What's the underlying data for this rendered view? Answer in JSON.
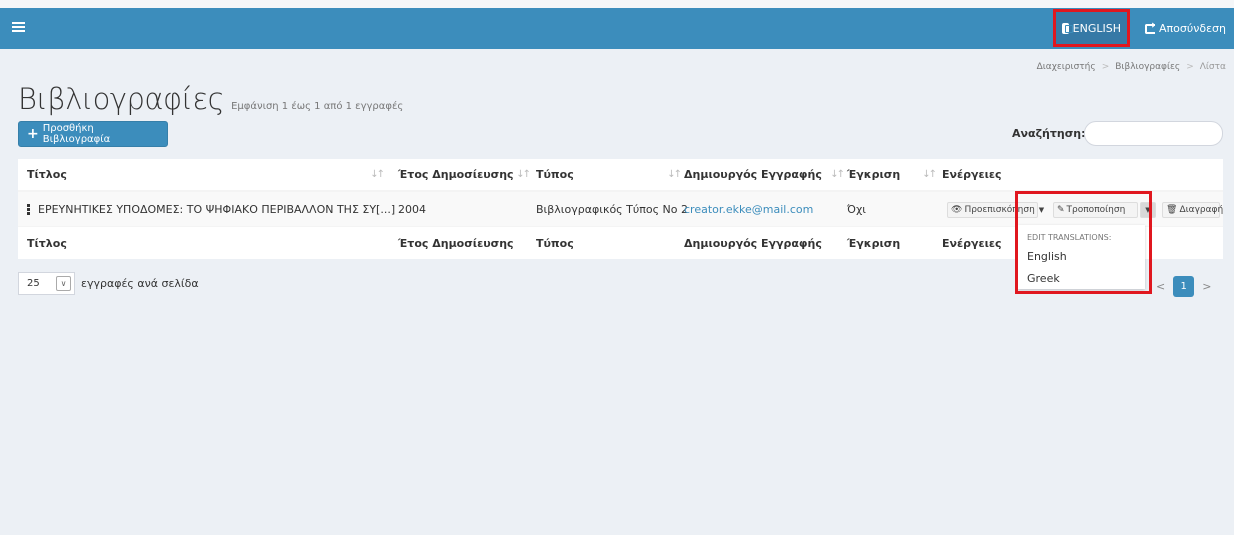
{
  "navbar": {
    "lang_label": "ENGLISH",
    "logout_label": "Αποσύνδεση",
    "lang_icon": "language-icon",
    "logout_icon": "logout-icon"
  },
  "breadcrumb": [
    "Διαχειριστής",
    "Βιβλιογραφίες",
    "Λίστα"
  ],
  "page": {
    "title": "Βιβλιογραφίες",
    "subtitle": "Εμφάνιση 1 έως 1 από 1 εγγραφές"
  },
  "add_button": "Προσθήκη Βιβλιογραφία",
  "search": {
    "label": "Αναζήτηση:",
    "value": ""
  },
  "table": {
    "headers": [
      "Τίτλος",
      "Έτος Δημοσίευσης",
      "Τύπος",
      "Δημιουργός Εγγραφής",
      "Έγκριση",
      "Ενέργειες"
    ],
    "rows": [
      {
        "title": "ΕΡΕΥΝΗΤΙΚΕΣ ΥΠΟΔΟΜΕΣ: ΤΟ ΨΗΦΙΑΚΟ ΠΕΡΙΒΑΛΛΟΝ ΤΗΣ ΣΥ[...]",
        "year": "2004",
        "type": "Βιβλιογραφικός Τύπος Νο 2",
        "creator": "creator.ekke@mail.com",
        "approval": "Όχι"
      }
    ],
    "actions": {
      "preview": "Προεπισκόπηση",
      "edit": "Τροποποίηση",
      "delete": "Διαγραφή"
    }
  },
  "dropdown": {
    "header": "EDIT TRANSLATIONS:",
    "items": [
      "English",
      "Greek"
    ]
  },
  "length": {
    "value": "25",
    "label": "εγγραφές ανά σελίδα"
  },
  "pager": {
    "prev": "<",
    "current": "1",
    "next": ">"
  },
  "colors": {
    "primary": "#3c8dbc",
    "highlight": "#e0171f",
    "background": "#ecf0f5"
  }
}
